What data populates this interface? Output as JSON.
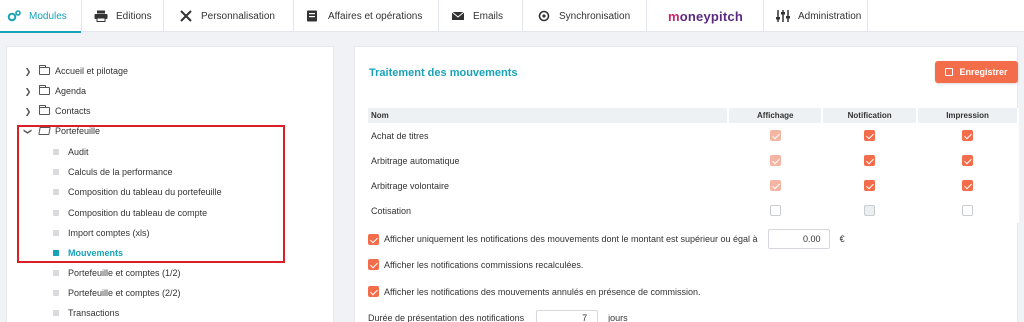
{
  "nav": {
    "tabs": [
      {
        "label": "Modules",
        "icon": "gears-icon",
        "active": true
      },
      {
        "label": "Editions",
        "icon": "printer-icon"
      },
      {
        "label": "Personnalisation",
        "icon": "tools-icon"
      },
      {
        "label": "Affaires et opérations",
        "icon": "ledger-icon"
      },
      {
        "label": "Emails",
        "icon": "envelope-icon"
      },
      {
        "label": "Synchronisation",
        "icon": "sync-icon"
      },
      {
        "label": "Administration",
        "icon": "sliders-icon"
      }
    ],
    "logo": {
      "prefix": "m",
      "rest": "oneypitch"
    }
  },
  "sidebar": {
    "folders": [
      {
        "label": "Accueil et pilotage"
      },
      {
        "label": "Agenda"
      },
      {
        "label": "Contacts"
      },
      {
        "label": "Portefeuille"
      }
    ],
    "items": [
      {
        "label": "Audit"
      },
      {
        "label": "Calculs de la performance"
      },
      {
        "label": "Composition du tableau du portefeuille"
      },
      {
        "label": "Composition du tableau de compte"
      },
      {
        "label": "Import comptes (xls)"
      },
      {
        "label": "Mouvements",
        "active": true
      },
      {
        "label": "Portefeuille et comptes (1/2)"
      },
      {
        "label": "Portefeuille et comptes (2/2)"
      },
      {
        "label": "Transactions"
      }
    ]
  },
  "main": {
    "title": "Traitement des mouvements",
    "save_label": "Enregistrer",
    "table": {
      "headers": [
        "Nom",
        "Affichage",
        "Notification",
        "Impression"
      ],
      "rows": [
        {
          "name": "Achat de titres",
          "affichage": "checked-dim",
          "notification": "checked",
          "impression": "checked"
        },
        {
          "name": "Arbitrage automatique",
          "affichage": "checked-dim",
          "notification": "checked",
          "impression": "checked"
        },
        {
          "name": "Arbitrage volontaire",
          "affichage": "checked-dim",
          "notification": "checked",
          "impression": "checked"
        },
        {
          "name": "Cotisation",
          "affichage": "unchecked",
          "notification": "disabled",
          "impression": "unchecked"
        }
      ]
    },
    "options": {
      "amount_label": "Afficher uniquement les notifications des mouvements dont le montant est supérieur ou égal à",
      "amount_value": "0.00",
      "amount_unit": "€",
      "commissions_label": "Afficher les notifications commissions recalculées.",
      "cancelled_label": "Afficher les notifications des mouvements annulés en présence de commission.",
      "duration_label": "Durée de présentation des notifications",
      "duration_value": "7",
      "duration_unit": "jours"
    }
  },
  "colors": {
    "accent": "#17a2b8",
    "orange": "#f36d4a",
    "highlight": "#d92027"
  }
}
